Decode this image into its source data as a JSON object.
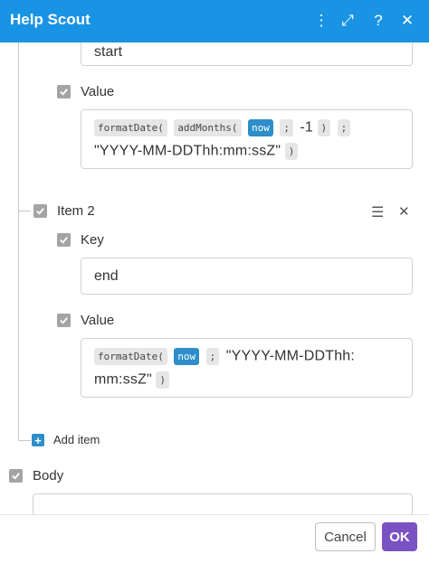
{
  "header": {
    "title": "Help Scout",
    "icons": [
      "more-vertical-icon",
      "expand-icon",
      "help-icon",
      "close-icon"
    ],
    "more_glyph": "⋮",
    "expand_glyph": "⤢",
    "help_glyph": "?",
    "close_glyph": "✕"
  },
  "item1": {
    "key_value": "start",
    "value_label": "Value",
    "value_tokens_line1": [
      "formatDate(",
      "addMonths(",
      "now",
      ";",
      "-1",
      ")",
      ";"
    ],
    "value_line2_text": "\"YYYY-MM-DDThh:mm:ssZ\"",
    "value_line2_close": ")"
  },
  "item2": {
    "label": "Item 2",
    "key_label": "Key",
    "key_value": "end",
    "value_label": "Value",
    "value_tokens_line1": [
      "formatDate(",
      "now",
      ";"
    ],
    "value_line1_text": "\"YYYY-MM-DDThh:",
    "value_line2_text": "mm:ssZ\"",
    "value_line2_close": ")",
    "menu_glyph": "☰",
    "remove_glyph": "✕"
  },
  "add_item": {
    "label": "Add item",
    "glyph": "+"
  },
  "body_section": {
    "label": "Body",
    "value": ""
  },
  "footer": {
    "cancel_label": "Cancel",
    "ok_label": "OK"
  },
  "colors": {
    "header": "#1993e4",
    "ok_button": "#7b52c4",
    "token_blue": "#2d8ec9"
  }
}
